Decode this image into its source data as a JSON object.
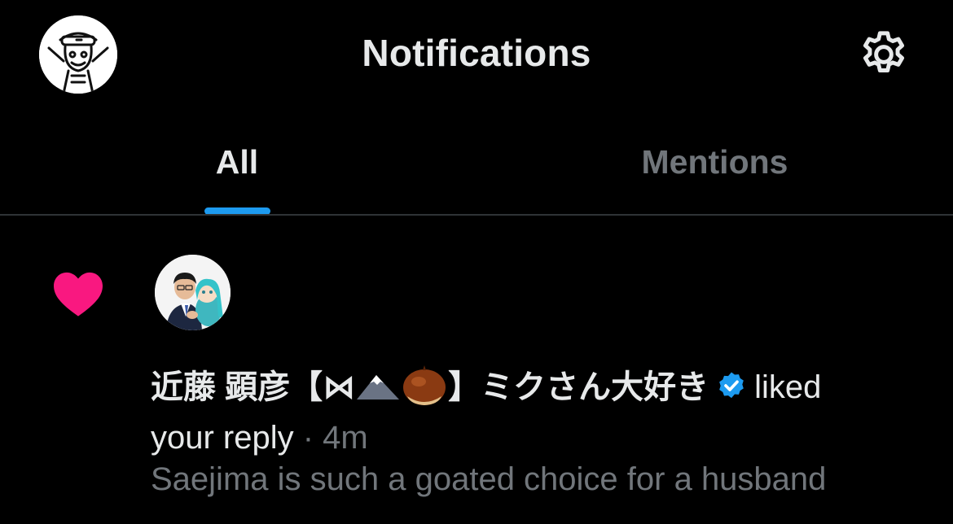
{
  "header": {
    "title": "Notifications",
    "avatar_icon": "user-avatar-sketch",
    "settings_icon": "gear-icon"
  },
  "tabs": [
    {
      "label": "All",
      "active": true
    },
    {
      "label": "Mentions",
      "active": false
    }
  ],
  "notification": {
    "type_icon": "heart-icon",
    "type_color": "#f91880",
    "name_part1": "近藤 顕彦【⋈",
    "name_part2": "】ミクさん大好き",
    "name_emojis": [
      "mountain-emoji",
      "chestnut-emoji"
    ],
    "verified_icon": "verified-badge-icon",
    "verified_color": "#1d9bf0",
    "action": "liked",
    "action_line2": "your reply",
    "separator": " · ",
    "time": "4m",
    "preview": "Saejima is such a goated choice for a husband"
  },
  "colors": {
    "background": "#000000",
    "text_primary": "#e7e9ea",
    "text_secondary": "#71767b",
    "accent": "#1d9bf0",
    "divider": "#2f3336"
  }
}
